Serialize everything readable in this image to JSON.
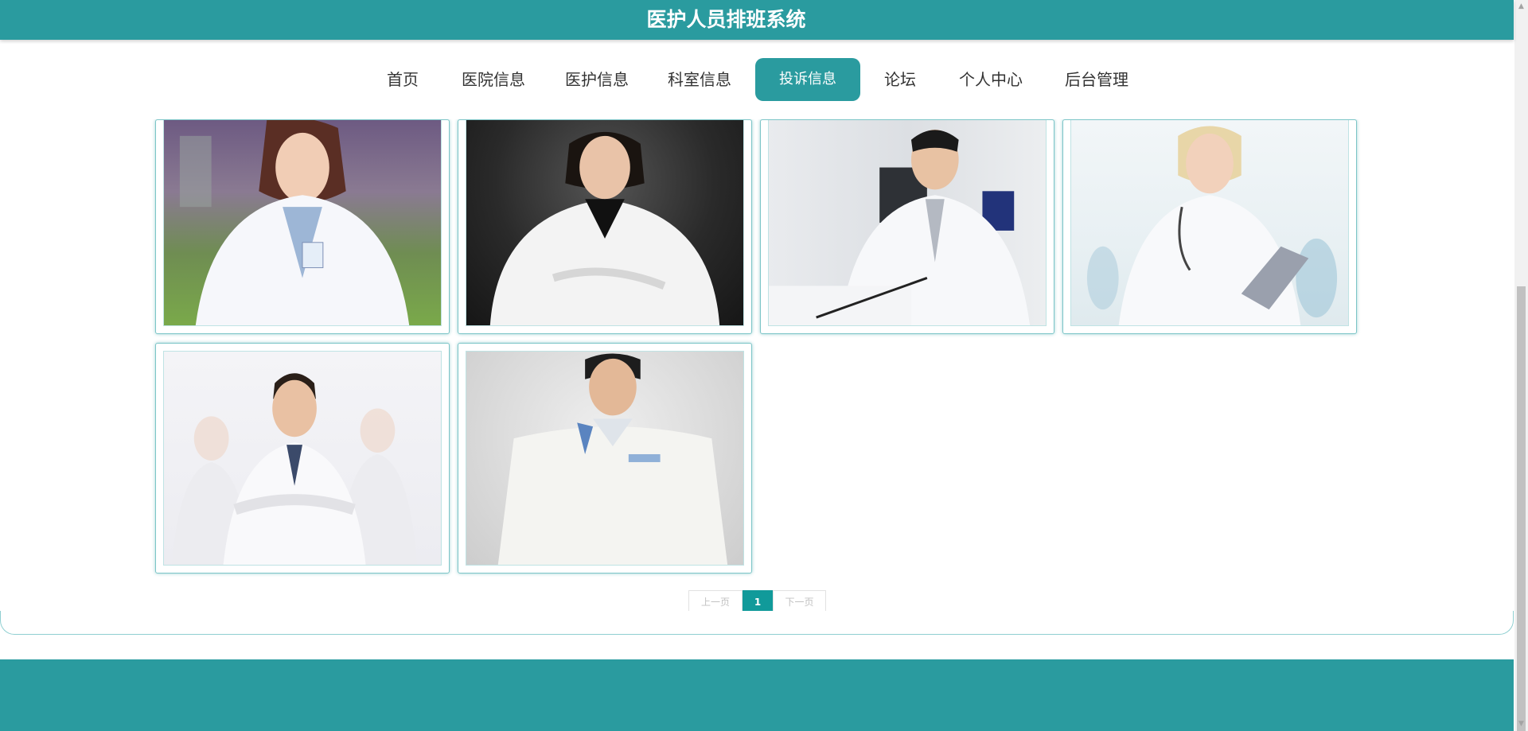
{
  "header": {
    "title": "医护人员排班系统"
  },
  "nav": {
    "items": [
      {
        "label": "首页",
        "active": false
      },
      {
        "label": "医院信息",
        "active": false
      },
      {
        "label": "医护信息",
        "active": false
      },
      {
        "label": "科室信息",
        "active": false
      },
      {
        "label": "投诉信息",
        "active": true
      },
      {
        "label": "论坛",
        "active": false
      },
      {
        "label": "个人中心",
        "active": false
      },
      {
        "label": "后台管理",
        "active": false
      }
    ]
  },
  "gallery": {
    "cards": [
      {
        "image": "female-doctor-outdoor-photo"
      },
      {
        "image": "female-doctor-dark-background-photo"
      },
      {
        "image": "male-doctor-at-desk-photo"
      },
      {
        "image": "female-doctor-with-clipboard-photo"
      },
      {
        "image": "male-doctor-arms-crossed-photo"
      },
      {
        "image": "male-doctor-standing-photo"
      }
    ]
  },
  "pagination": {
    "prev_label": "上一页",
    "current_page": "1",
    "next_label": "下一页"
  },
  "theme": {
    "primary": "#2a9b9f",
    "card_border": "#7cc5c7",
    "pager_active": "#119a9a"
  },
  "scrollbar": {
    "up_icon": "triangle-up",
    "down_icon": "triangle-down"
  }
}
